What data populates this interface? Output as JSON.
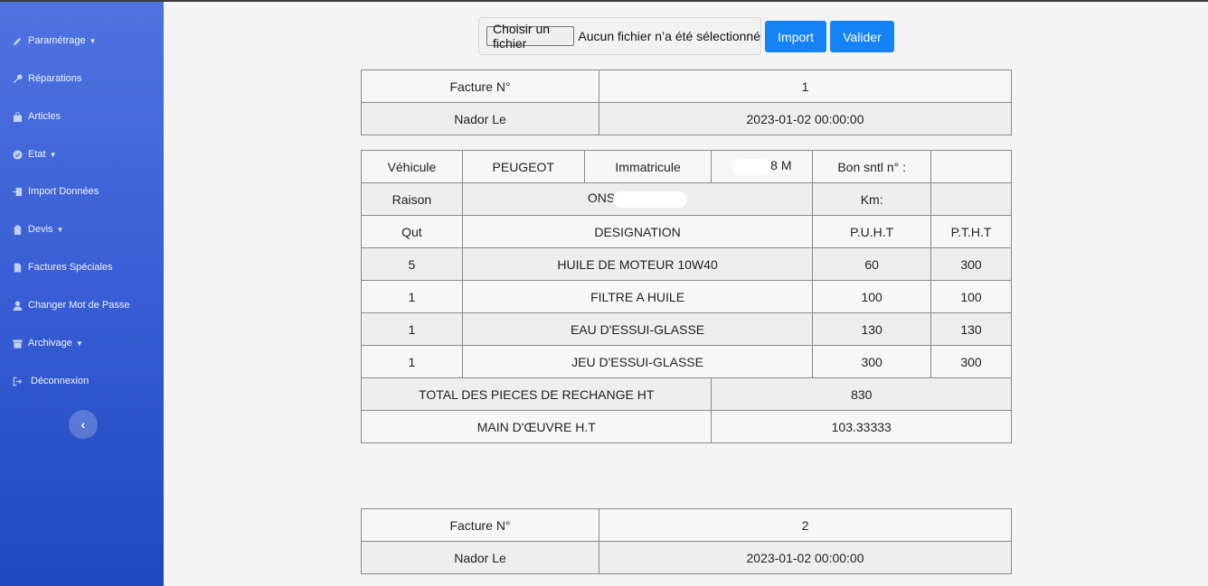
{
  "sidebar": {
    "items": [
      {
        "label": "Paramétrage",
        "icon": "pencil-icon",
        "dropdown": true
      },
      {
        "label": "Réparations",
        "icon": "wrench-icon",
        "dropdown": false
      },
      {
        "label": "Articles",
        "icon": "bag-icon",
        "dropdown": false
      },
      {
        "label": "Etat",
        "icon": "check-circle-icon",
        "dropdown": true
      },
      {
        "label": "Import Données",
        "icon": "file-import-icon",
        "dropdown": false
      },
      {
        "label": "Devis",
        "icon": "clipboard-icon",
        "dropdown": true
      },
      {
        "label": "Factures Spéciales",
        "icon": "file-icon",
        "dropdown": false
      },
      {
        "label": "Changer Mot de Passe",
        "icon": "user-icon",
        "dropdown": false
      },
      {
        "label": "Archivage",
        "icon": "archive-icon",
        "dropdown": true
      },
      {
        "label": "Déconnexion",
        "icon": "sign-out-icon",
        "dropdown": false
      }
    ],
    "toggle_icon": "chevron-left-icon"
  },
  "upload": {
    "choose_label": "Choisir un fichier",
    "status_text": "Aucun fichier n’a été sélectionné",
    "import_label": "Import",
    "validate_label": "Valider"
  },
  "invoice1": {
    "header": {
      "facture_label": "Facture N°",
      "facture_value": "1",
      "place_label": "Nador Le",
      "date_value": "2023-01-02 00:00:00"
    },
    "vehicle": {
      "vehicule_label": "Véhicule",
      "vehicule_value": "PEUGEOT",
      "immat_label": "Immatricule",
      "immat_value": "8 M",
      "bon_label": "Bon sntl n° :",
      "bon_value": "",
      "raison_label": "Raison",
      "raison_value": "ONS",
      "km_label": "Km:",
      "km_value": ""
    },
    "columns": [
      "Qut",
      "DESIGNATION",
      "P.U.H.T",
      "P.T.H.T"
    ],
    "rows": [
      {
        "qty": "5",
        "designation": "HUILE DE MOTEUR 10W40",
        "puht": "60",
        "ptht": "300"
      },
      {
        "qty": "1",
        "designation": "FILTRE A HUILE",
        "puht": "100",
        "ptht": "100"
      },
      {
        "qty": "1",
        "designation": "EAU D'ESSUI-GLASSE",
        "puht": "130",
        "ptht": "130"
      },
      {
        "qty": "1",
        "designation": "JEU D'ESSUI-GLASSE",
        "puht": "300",
        "ptht": "300"
      }
    ],
    "totals": {
      "pieces_label": "TOTAL DES PIECES DE RECHANGE HT",
      "pieces_value": "830",
      "main_oeuvre_label": "MAIN D'ŒUVRE H.T",
      "main_oeuvre_value": "103.33333"
    }
  },
  "invoice2": {
    "header": {
      "facture_label": "Facture N°",
      "facture_value": "2",
      "place_label": "Nador Le",
      "date_value": "2023-01-02 00:00:00"
    }
  },
  "colors": {
    "sidebar_top": "#4f73df",
    "sidebar_bottom": "#2148bf",
    "primary_button": "#1583f5"
  }
}
